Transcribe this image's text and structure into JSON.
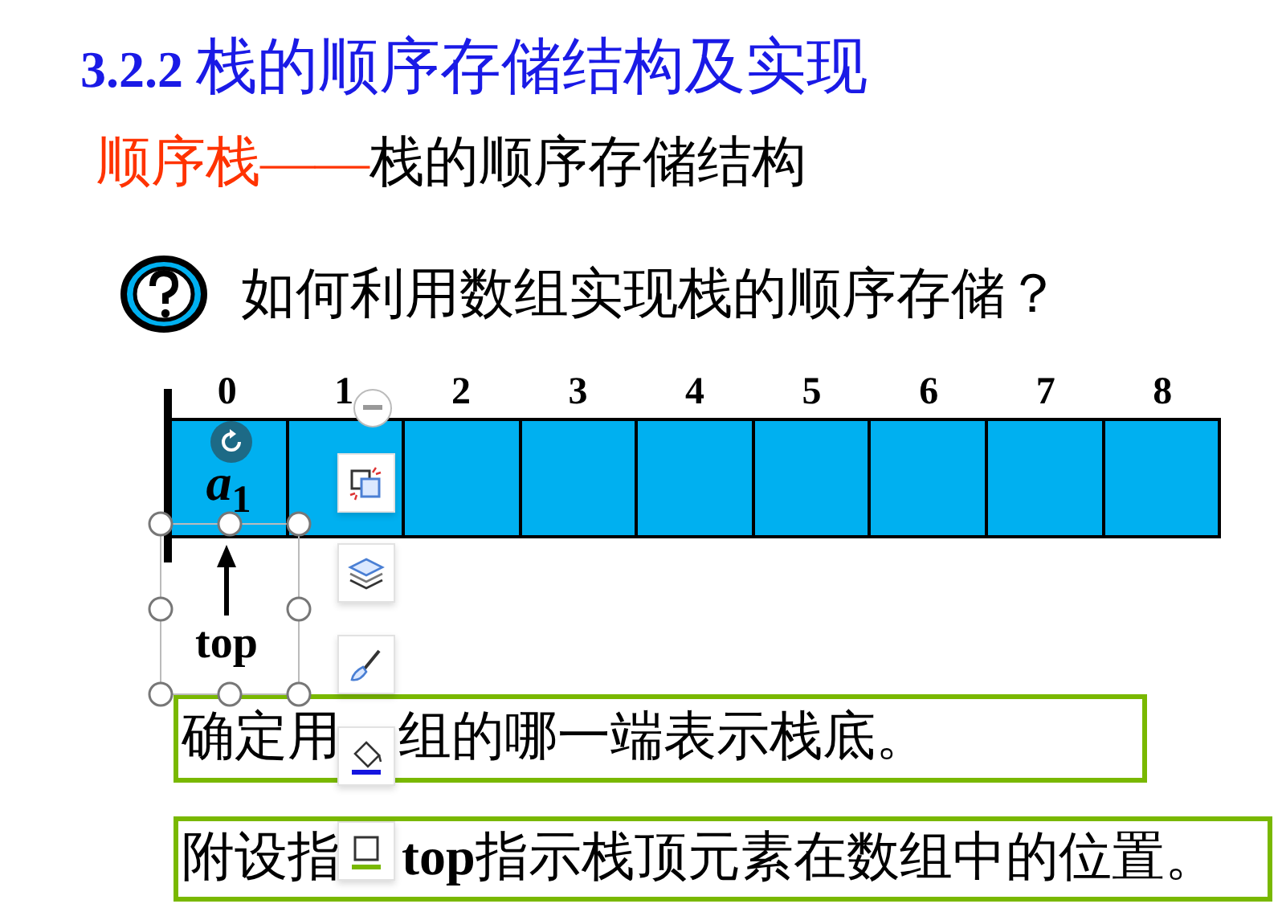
{
  "slide": {
    "title": {
      "number": "3.2.2",
      "text": "栈的顺序存储结构及实现"
    },
    "subtitle": {
      "term": "顺序栈",
      "dash": "——",
      "definition": "栈的顺序存储结构"
    },
    "question": "如何利用数组实现栈的顺序存储？",
    "array": {
      "indices": [
        "0",
        "1",
        "2",
        "3",
        "4",
        "5",
        "6",
        "7",
        "8"
      ],
      "element": {
        "base": "a",
        "subscript": "1"
      }
    },
    "pointer_label": "top",
    "notes": [
      {
        "parts": [
          "确定用",
          "组的哪一端表示栈底。"
        ]
      },
      {
        "parts": [
          "附设指",
          "**top**指示栈顶元素在数组中的位置。"
        ]
      }
    ]
  },
  "toolbar": [
    {
      "kind": "collapse"
    },
    {
      "kind": "crop"
    },
    {
      "kind": "layers"
    },
    {
      "kind": "brush"
    },
    {
      "kind": "fill"
    },
    {
      "kind": "border"
    }
  ]
}
